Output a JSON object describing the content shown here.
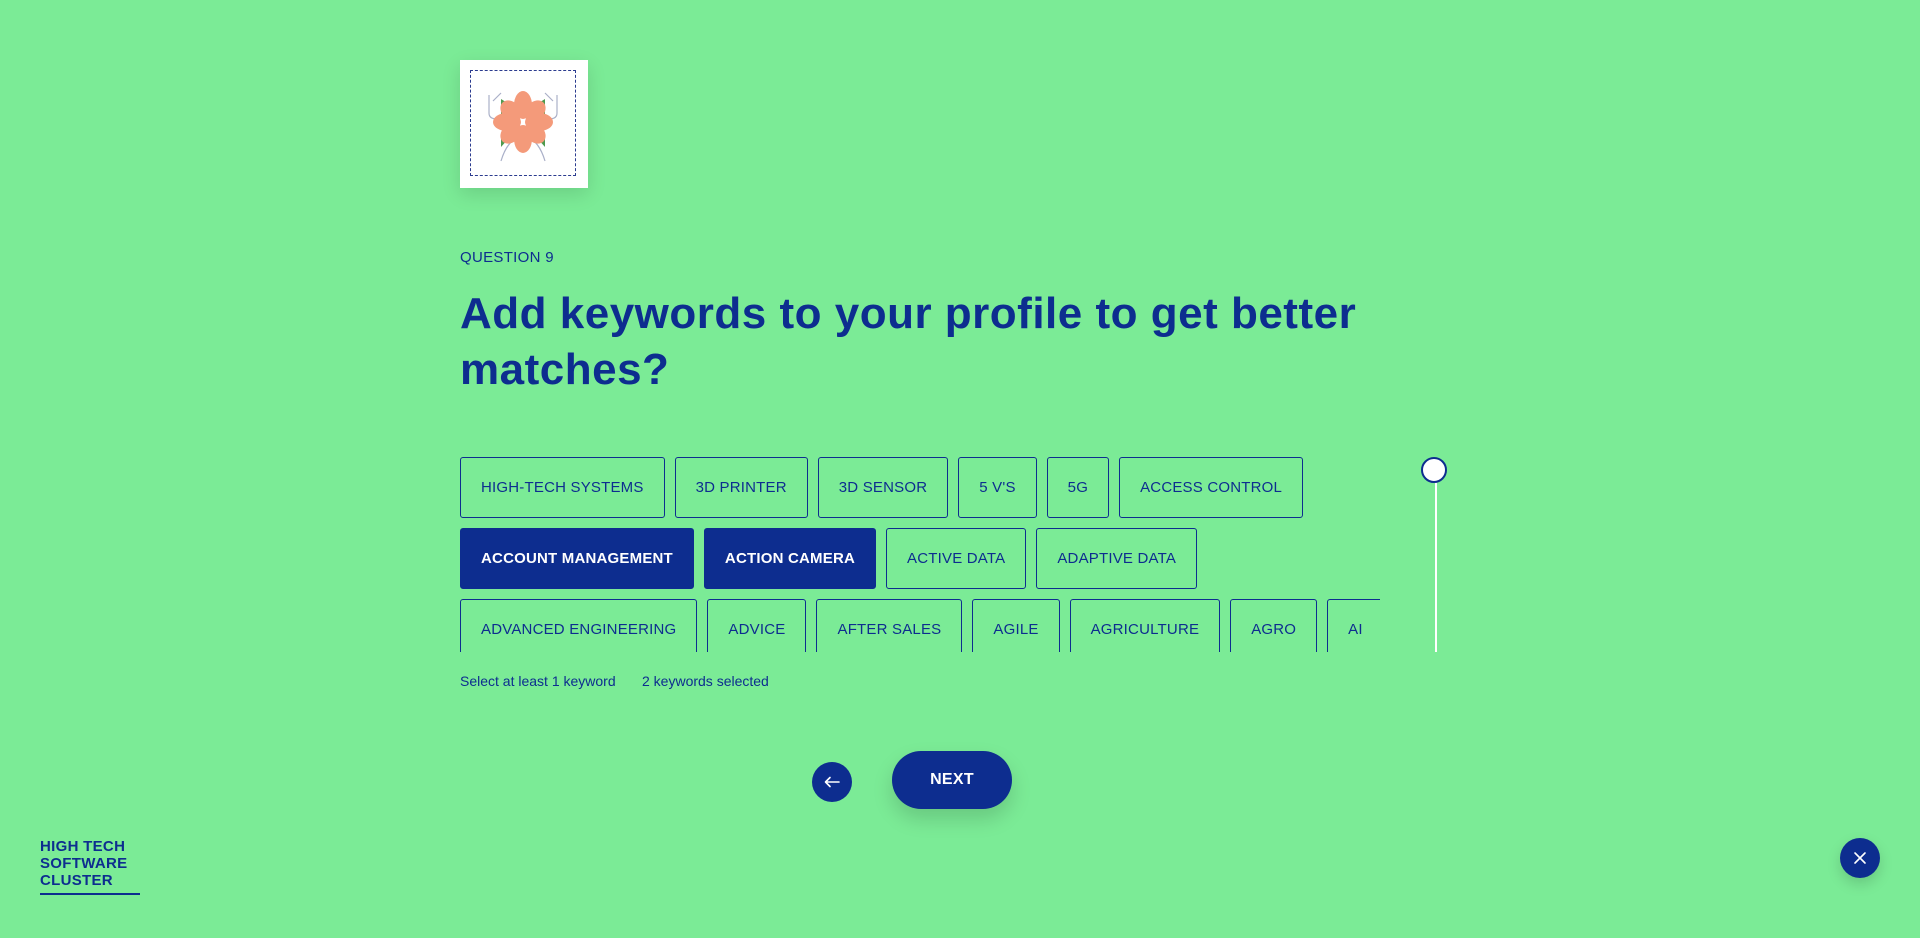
{
  "question": {
    "label": "QUESTION 9",
    "title": "Add keywords to your profile to get better matches?"
  },
  "keywords": {
    "rows": [
      [
        {
          "label": "HIGH-TECH SYSTEMS",
          "selected": false
        },
        {
          "label": "3D PRINTER",
          "selected": false
        },
        {
          "label": "3D SENSOR",
          "selected": false
        },
        {
          "label": "5 V'S",
          "selected": false
        },
        {
          "label": "5G",
          "selected": false
        },
        {
          "label": "ACCESS CONTROL",
          "selected": false
        }
      ],
      [
        {
          "label": "ACCOUNT MANAGEMENT",
          "selected": true
        },
        {
          "label": "ACTION CAMERA",
          "selected": true
        },
        {
          "label": "ACTIVE DATA",
          "selected": false
        },
        {
          "label": "ADAPTIVE DATA",
          "selected": false
        }
      ],
      [
        {
          "label": "ADVANCED ENGINEERING",
          "selected": false
        },
        {
          "label": "ADVICE",
          "selected": false
        },
        {
          "label": "AFTER SALES",
          "selected": false
        },
        {
          "label": "AGILE",
          "selected": false
        },
        {
          "label": "AGRICULTURE",
          "selected": false
        },
        {
          "label": "AGRO",
          "selected": false
        },
        {
          "label": "AI",
          "selected": false
        }
      ]
    ],
    "min_hint": "Select at least 1 keyword",
    "count_hint": "2 keywords selected"
  },
  "nav": {
    "back_icon": "arrow-left-icon",
    "next_label": "NEXT"
  },
  "logo": {
    "lines": [
      "HIGH TECH",
      "SOFTWARE",
      "CLUSTER"
    ]
  },
  "close": {
    "icon": "close-icon"
  },
  "colors": {
    "background": "#7beb96",
    "primary": "#0d2d8f",
    "white": "#ffffff",
    "illustration_orange": "#f49a7a",
    "illustration_green": "#4e9a4e"
  }
}
